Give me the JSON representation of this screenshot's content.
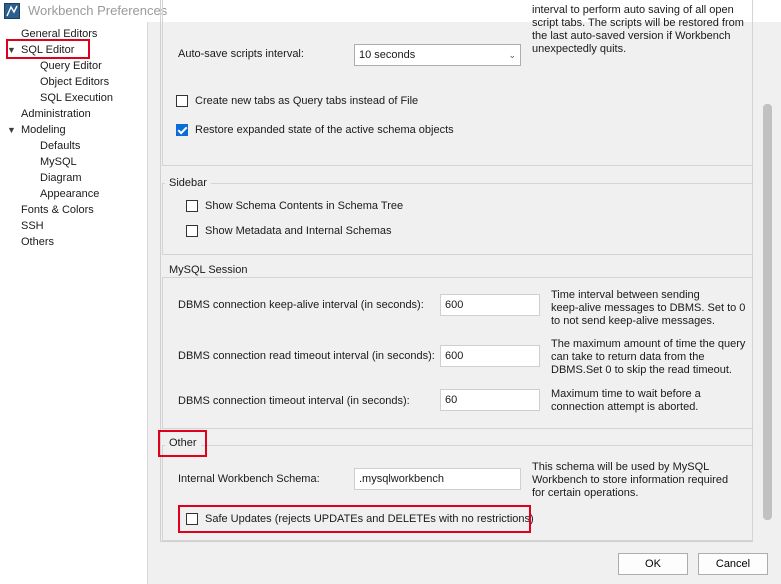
{
  "window": {
    "title": "Workbench Preferences"
  },
  "tree": {
    "items": [
      {
        "label": "General Editors"
      },
      {
        "label": "SQL Editor",
        "expanded": true
      },
      {
        "label": "Query Editor"
      },
      {
        "label": "Object Editors"
      },
      {
        "label": "SQL Execution"
      },
      {
        "label": "Administration"
      },
      {
        "label": "Modeling",
        "expanded": true
      },
      {
        "label": "Defaults"
      },
      {
        "label": "MySQL"
      },
      {
        "label": "Diagram"
      },
      {
        "label": "Appearance"
      },
      {
        "label": "Fonts & Colors"
      },
      {
        "label": "SSH"
      },
      {
        "label": "Others"
      }
    ],
    "expanded_icon": "triangle-down"
  },
  "general": {
    "autosave_label": "Auto-save scripts interval:",
    "autosave_value": "10 seconds",
    "autosave_desc": [
      "interval to perform auto saving of all open",
      "script tabs. The scripts will be restored from",
      "the last auto-saved version if Workbench",
      "unexpectedly quits."
    ],
    "query_tabs": {
      "label": "Create new tabs as Query tabs instead of File",
      "checked": false
    },
    "restore_state": {
      "label": "Restore expanded state of the active schema objects",
      "checked": true
    }
  },
  "sidebar": {
    "title": "Sidebar",
    "schema_contents": {
      "label": "Show Schema Contents in Schema Tree",
      "checked": false
    },
    "metadata": {
      "label": "Show Metadata and Internal Schemas",
      "checked": false
    }
  },
  "mysql_session": {
    "title": "MySQL Session",
    "keepalive": {
      "label": "DBMS connection keep-alive interval (in seconds):",
      "value": "600",
      "desc": [
        "Time interval between sending",
        "keep-alive messages to DBMS. Set to 0",
        "to not send keep-alive messages."
      ]
    },
    "read_timeout": {
      "label": "DBMS connection read timeout interval (in seconds):",
      "value": "600",
      "desc": [
        "The maximum amount of time the query",
        "can take to return data from the",
        "DBMS.Set 0 to skip the read timeout."
      ]
    },
    "conn_timeout": {
      "label": "DBMS connection timeout interval (in seconds):",
      "value": "60",
      "desc": [
        "Maximum time to wait before a",
        "connection attempt is aborted."
      ]
    }
  },
  "other": {
    "title": "Other",
    "schema": {
      "label": "Internal Workbench Schema:",
      "value": ".mysqlworkbench",
      "desc": [
        "This schema will be used by MySQL",
        "Workbench to store information required",
        "for certain operations."
      ]
    },
    "safe_updates": {
      "label": "Safe Updates (rejects UPDATEs and DELETEs with no restrictions)",
      "checked": false
    }
  },
  "buttons": {
    "ok": "OK",
    "cancel": "Cancel"
  },
  "colors": {
    "highlight": "#e0001b",
    "accent": "#0a6cd6"
  }
}
